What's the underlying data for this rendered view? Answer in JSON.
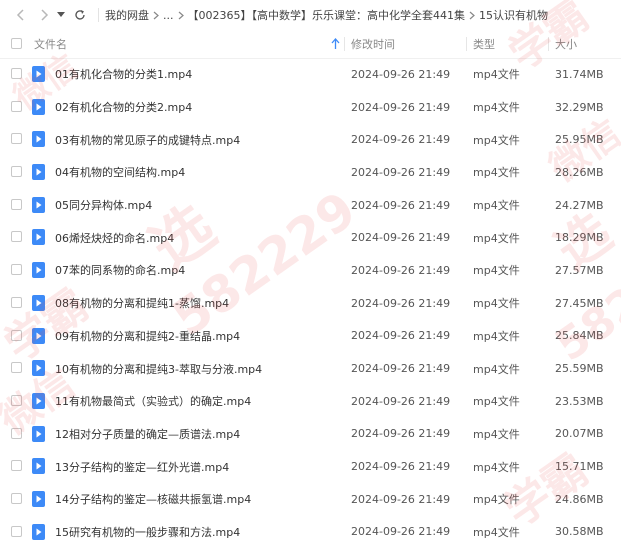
{
  "breadcrumb": [
    "我的网盘",
    "...",
    "【002365】【高中数学】乐乐课堂：高中化学全套441集",
    "15认识有机物"
  ],
  "columns": {
    "name": "文件名",
    "time": "修改时间",
    "type": "类型",
    "size": "大小"
  },
  "colors": {
    "file_icon": "#3d8af7",
    "sort_arrow": "#3d8af7",
    "watermark": "#e65050"
  },
  "watermark": {
    "text1": "学霸",
    "text2": "微信",
    "text3": "选",
    "text4": "582229",
    "text5": "5822"
  },
  "files": [
    {
      "name": "01有机化合物的分类1.mp4",
      "time": "2024-09-26 21:49",
      "type": "mp4文件",
      "size": "31.74MB"
    },
    {
      "name": "02有机化合物的分类2.mp4",
      "time": "2024-09-26 21:49",
      "type": "mp4文件",
      "size": "32.29MB"
    },
    {
      "name": "03有机物的常见原子的成键特点.mp4",
      "time": "2024-09-26 21:49",
      "type": "mp4文件",
      "size": "25.95MB"
    },
    {
      "name": "04有机物的空间结构.mp4",
      "time": "2024-09-26 21:49",
      "type": "mp4文件",
      "size": "28.26MB"
    },
    {
      "name": "05同分异构体.mp4",
      "time": "2024-09-26 21:49",
      "type": "mp4文件",
      "size": "24.27MB"
    },
    {
      "name": "06烯烃炔烃的命名.mp4",
      "time": "2024-09-26 21:49",
      "type": "mp4文件",
      "size": "18.29MB"
    },
    {
      "name": "07苯的同系物的命名.mp4",
      "time": "2024-09-26 21:49",
      "type": "mp4文件",
      "size": "27.57MB"
    },
    {
      "name": "08有机物的分离和提纯1-蒸馏.mp4",
      "time": "2024-09-26 21:49",
      "type": "mp4文件",
      "size": "27.45MB"
    },
    {
      "name": "09有机物的分离和提纯2-重结晶.mp4",
      "time": "2024-09-26 21:49",
      "type": "mp4文件",
      "size": "25.84MB"
    },
    {
      "name": "10有机物的分离和提纯3-萃取与分液.mp4",
      "time": "2024-09-26 21:49",
      "type": "mp4文件",
      "size": "25.59MB"
    },
    {
      "name": "11有机物最简式（实验式）的确定.mp4",
      "time": "2024-09-26 21:49",
      "type": "mp4文件",
      "size": "23.53MB"
    },
    {
      "name": "12相对分子质量的确定—质谱法.mp4",
      "time": "2024-09-26 21:49",
      "type": "mp4文件",
      "size": "20.07MB"
    },
    {
      "name": "13分子结构的鉴定—红外光谱.mp4",
      "time": "2024-09-26 21:49",
      "type": "mp4文件",
      "size": "15.71MB"
    },
    {
      "name": "14分子结构的鉴定—核磁共振氢谱.mp4",
      "time": "2024-09-26 21:49",
      "type": "mp4文件",
      "size": "24.86MB"
    },
    {
      "name": "15研究有机物的一般步骤和方法.mp4",
      "time": "2024-09-26 21:49",
      "type": "mp4文件",
      "size": "30.58MB"
    }
  ]
}
